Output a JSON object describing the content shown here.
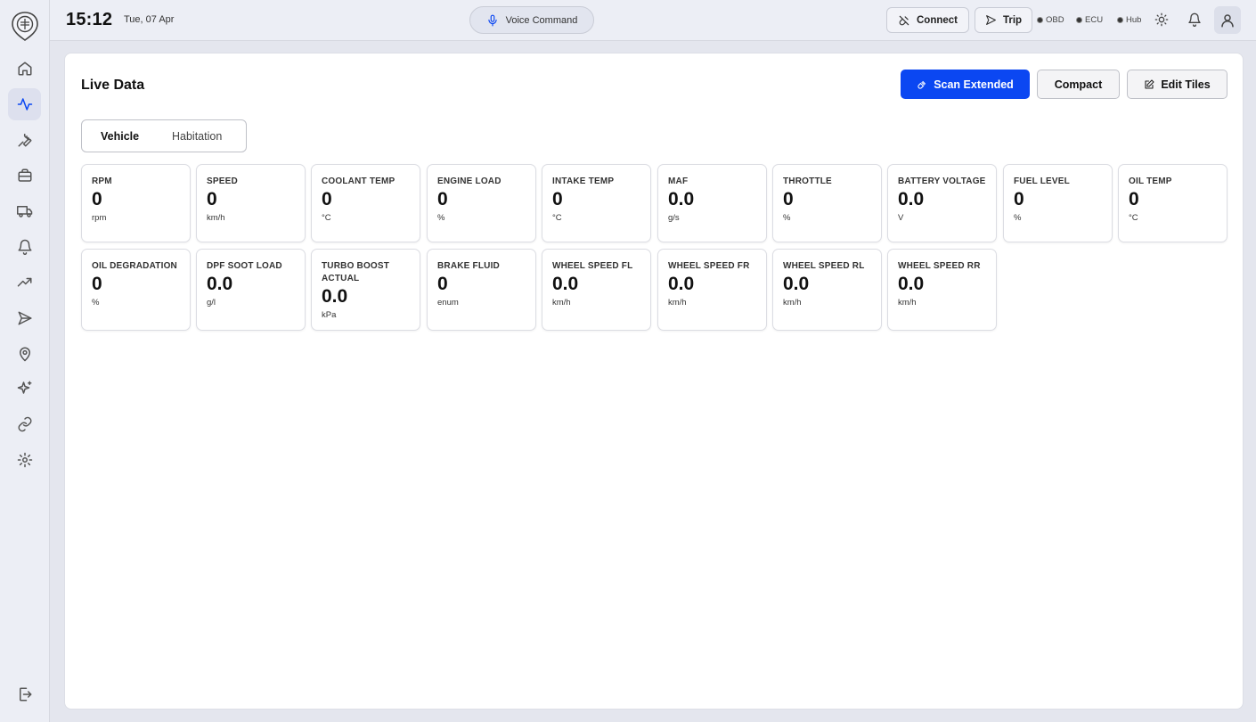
{
  "header": {
    "time": "15:12",
    "date": "Tue, 07 Apr",
    "voice_label": "Voice Command",
    "connect_label": "Connect",
    "trip_label": "Trip",
    "status": [
      {
        "label": "OBD"
      },
      {
        "label": "ECU"
      },
      {
        "label": "Hub"
      }
    ]
  },
  "sidebar": {
    "items": [
      {
        "icon": "home-icon"
      },
      {
        "icon": "activity-icon",
        "active": true
      },
      {
        "icon": "wrench-icon"
      },
      {
        "icon": "toolbox-icon"
      },
      {
        "icon": "truck-icon"
      },
      {
        "icon": "bell-icon"
      },
      {
        "icon": "trending-icon"
      },
      {
        "icon": "send-icon"
      },
      {
        "icon": "map-pin-icon"
      },
      {
        "icon": "sparkles-icon"
      },
      {
        "icon": "link-icon"
      },
      {
        "icon": "gear-icon"
      }
    ]
  },
  "main": {
    "title": "Live Data",
    "scan_label": "Scan Extended",
    "compact_label": "Compact",
    "edit_label": "Edit Tiles",
    "tabs": [
      "Vehicle",
      "Habitation"
    ],
    "tiles": [
      {
        "label": "RPM",
        "value": "0",
        "unit": "rpm"
      },
      {
        "label": "SPEED",
        "value": "0",
        "unit": "km/h"
      },
      {
        "label": "COOLANT TEMP",
        "value": "0",
        "unit": "°C"
      },
      {
        "label": "ENGINE LOAD",
        "value": "0",
        "unit": "%"
      },
      {
        "label": "INTAKE TEMP",
        "value": "0",
        "unit": "°C"
      },
      {
        "label": "MAF",
        "value": "0.0",
        "unit": "g/s"
      },
      {
        "label": "THROTTLE",
        "value": "0",
        "unit": "%"
      },
      {
        "label": "BATTERY VOLTAGE",
        "value": "0.0",
        "unit": "V"
      },
      {
        "label": "FUEL LEVEL",
        "value": "0",
        "unit": "%"
      },
      {
        "label": "OIL TEMP",
        "value": "0",
        "unit": "°C"
      },
      {
        "label": "OIL DEGRADATION",
        "value": "0",
        "unit": "%"
      },
      {
        "label": "DPF SOOT LOAD",
        "value": "0.0",
        "unit": "g/l"
      },
      {
        "label": "TURBO BOOST ACTUAL",
        "value": "0.0",
        "unit": "kPa"
      },
      {
        "label": "BRAKE FLUID",
        "value": "0",
        "unit": "enum"
      },
      {
        "label": "WHEEL SPEED FL",
        "value": "0.0",
        "unit": "km/h"
      },
      {
        "label": "WHEEL SPEED FR",
        "value": "0.0",
        "unit": "km/h"
      },
      {
        "label": "WHEEL SPEED RL",
        "value": "0.0",
        "unit": "km/h"
      },
      {
        "label": "WHEEL SPEED RR",
        "value": "0.0",
        "unit": "km/h"
      }
    ]
  },
  "colors": {
    "accent": "#0b47f2"
  }
}
